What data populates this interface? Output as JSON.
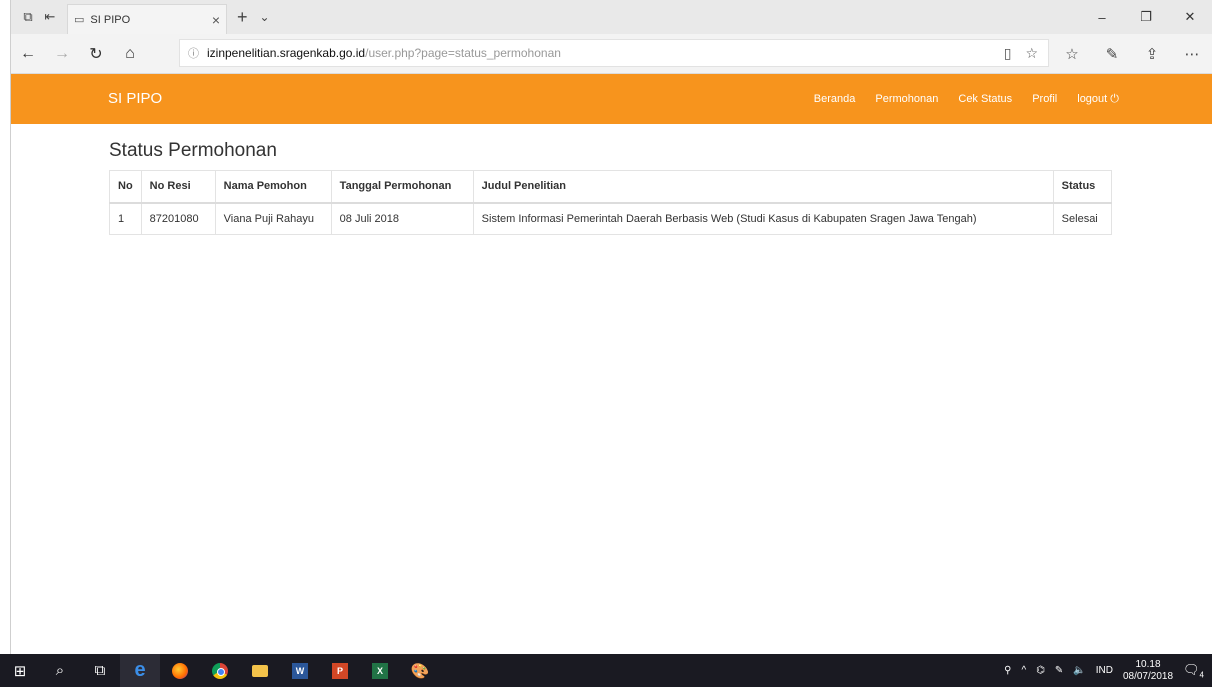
{
  "browser": {
    "tab_title": "SI PIPO",
    "url_host": "izinpenelitian.sragenkab.go.id",
    "url_path": "/user.php?page=status_permohonan"
  },
  "site": {
    "brand": "SI PIPO",
    "menu": [
      "Beranda",
      "Permohonan",
      "Cek Status",
      "Profil",
      "logout"
    ]
  },
  "main": {
    "page_title": "Status Permohonan",
    "table": {
      "headers": [
        "No",
        "No Resi",
        "Nama Pemohon",
        "Tanggal Permohonan",
        "Judul Penelitian",
        "Status"
      ],
      "rows": [
        [
          "1",
          "87201080",
          "Viana Puji Rahayu",
          "08 Juli 2018",
          "Sistem Informasi Pemerintah Daerah Berbasis Web (Studi Kasus di Kabupaten Sragen Jawa Tengah)",
          "Selesai"
        ]
      ]
    }
  },
  "taskbar": {
    "lang": "IND",
    "time": "10.18",
    "date": "08/07/2018",
    "notification_count": "4"
  },
  "colors": {
    "accent": "#f7941d"
  }
}
